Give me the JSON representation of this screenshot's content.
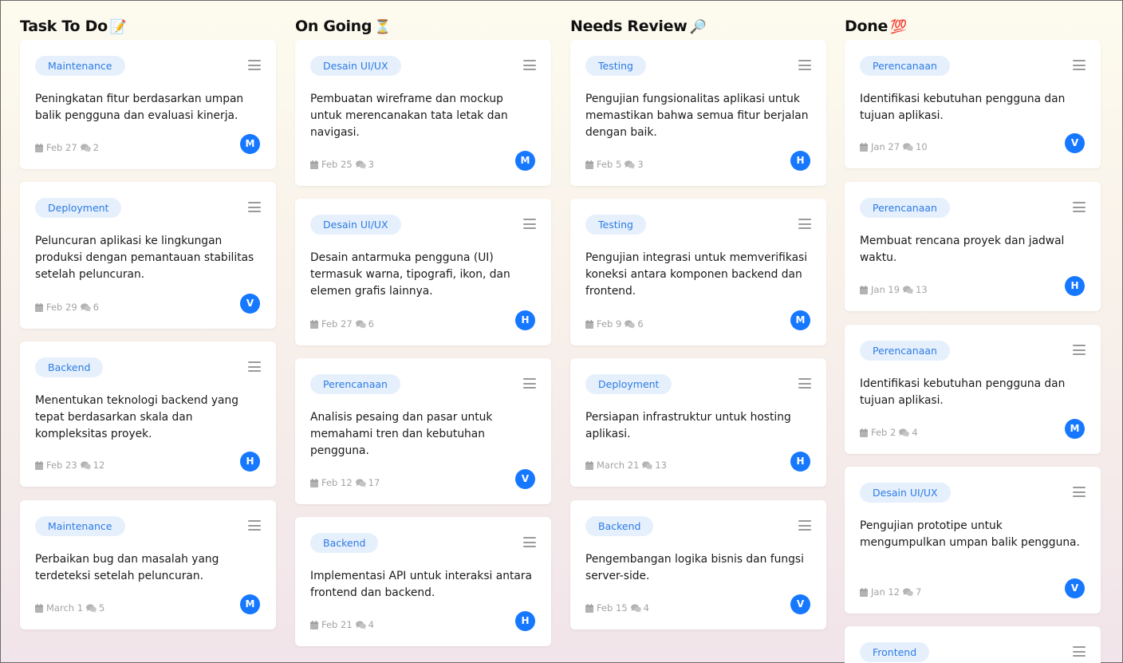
{
  "columns": [
    {
      "title": "Task To Do",
      "emoji": "📝",
      "cards": [
        {
          "tag": "Maintenance",
          "desc": "Peningkatan fitur berdasarkan umpan balik pengguna dan evaluasi kinerja.",
          "date": "Feb 27",
          "comments": "2",
          "avatar": "M"
        },
        {
          "tag": "Deployment",
          "desc": "Peluncuran aplikasi ke lingkungan produksi dengan pemantauan stabilitas setelah peluncuran.",
          "date": "Feb 29",
          "comments": "6",
          "avatar": "V"
        },
        {
          "tag": "Backend",
          "desc": "Menentukan teknologi backend yang tepat berdasarkan skala dan kompleksitas proyek.",
          "date": "Feb 23",
          "comments": "12",
          "avatar": "H"
        },
        {
          "tag": "Maintenance",
          "desc": "Perbaikan bug dan masalah yang terdeteksi setelah peluncuran.",
          "date": "March 1",
          "comments": "5",
          "avatar": "M"
        }
      ]
    },
    {
      "title": "On Going",
      "emoji": "⏳",
      "cards": [
        {
          "tag": "Desain UI/UX",
          "desc": "Pembuatan wireframe dan mockup untuk merencanakan tata letak dan navigasi.",
          "date": "Feb 25",
          "comments": "3",
          "avatar": "M"
        },
        {
          "tag": "Desain UI/UX",
          "desc": "Desain antarmuka pengguna (UI) termasuk warna, tipografi, ikon, dan elemen grafis lainnya.",
          "date": "Feb 27",
          "comments": "6",
          "avatar": "H"
        },
        {
          "tag": "Perencanaan",
          "desc": "Analisis pesaing dan pasar untuk memahami tren dan kebutuhan pengguna.",
          "date": "Feb 12",
          "comments": "17",
          "avatar": "V"
        },
        {
          "tag": "Backend",
          "desc": "Implementasi API untuk interaksi antara frontend dan backend.",
          "date": "Feb 21",
          "comments": "4",
          "avatar": "H"
        }
      ]
    },
    {
      "title": "Needs Review",
      "emoji": "🔎",
      "cards": [
        {
          "tag": "Testing",
          "desc": "Pengujian fungsionalitas aplikasi untuk memastikan bahwa semua fitur berjalan dengan baik.",
          "date": "Feb 5",
          "comments": "3",
          "avatar": "H"
        },
        {
          "tag": "Testing",
          "desc": "Pengujian integrasi untuk memverifikasi koneksi antara komponen backend dan frontend.",
          "date": "Feb 9",
          "comments": "6",
          "avatar": "M"
        },
        {
          "tag": "Deployment",
          "desc": "Persiapan infrastruktur untuk hosting aplikasi.",
          "date": "March 21",
          "comments": "13",
          "avatar": "H"
        },
        {
          "tag": "Backend",
          "desc": "Pengembangan logika bisnis dan fungsi server-side.",
          "date": "Feb 15",
          "comments": "4",
          "avatar": "V"
        }
      ]
    },
    {
      "title": "Done",
      "emoji": "💯",
      "cards": [
        {
          "tag": "Perencanaan",
          "desc": "Identifikasi kebutuhan pengguna dan tujuan aplikasi.",
          "date": "Jan 27",
          "comments": "10",
          "avatar": "V"
        },
        {
          "tag": "Perencanaan",
          "desc": "Membuat rencana proyek dan jadwal waktu.",
          "date": "Jan 19",
          "comments": "13",
          "avatar": "H"
        },
        {
          "tag": "Perencanaan",
          "desc": "Identifikasi kebutuhan pengguna dan tujuan aplikasi.",
          "date": "Feb 2",
          "comments": "4",
          "avatar": "M"
        },
        {
          "tag": "Desain UI/UX",
          "desc": "Pengujian prototipe untuk mengumpulkan umpan balik pengguna.",
          "date": "Jan 12",
          "comments": "7",
          "avatar": "V"
        },
        {
          "tag": "Frontend",
          "desc": "",
          "date": "",
          "comments": "",
          "avatar": ""
        }
      ]
    }
  ],
  "colors": {
    "tag_bg": "#e6f0fc",
    "tag_text": "#2c7be5",
    "avatar_bg": "#1677ff",
    "meta_text": "#a3a3a3"
  }
}
